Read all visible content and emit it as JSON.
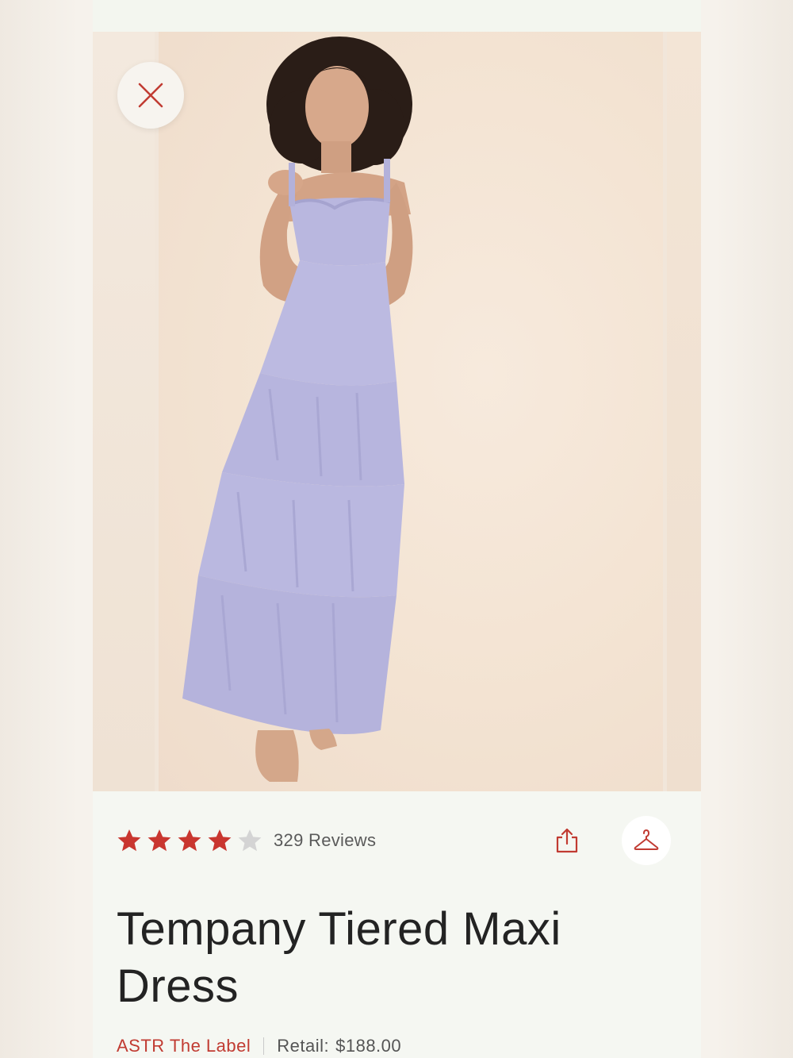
{
  "product": {
    "rating": 4,
    "rating_max": 5,
    "reviews_label": "329 Reviews",
    "title": "Tempany Tiered Maxi Dress",
    "brand": "ASTR The Label",
    "retail_label": "Retail:",
    "retail_price": "$188.00"
  },
  "icons": {
    "close": "close-icon",
    "share": "share-icon",
    "hanger": "hanger-icon",
    "star": "star-icon"
  },
  "colors": {
    "accent": "#c13b32",
    "star_filled": "#c9362f",
    "star_empty": "#d4d4d4",
    "dress": "#b8b6de"
  }
}
